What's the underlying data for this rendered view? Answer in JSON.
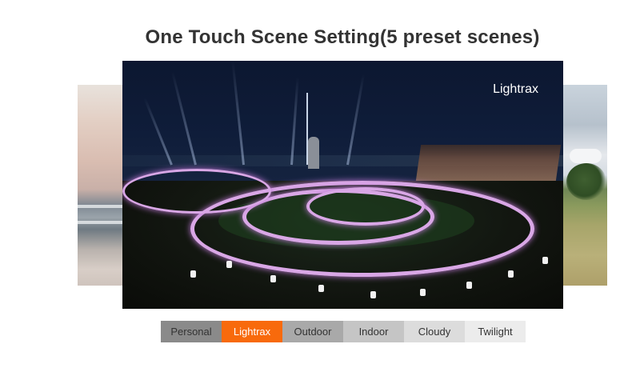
{
  "title": "One Touch Scene Setting(5 preset scenes)",
  "main_image": {
    "scene_label": "Lightrax"
  },
  "colors": {
    "accent": "#f86a0c",
    "text": "#333333"
  },
  "tabs": [
    {
      "label": "Personal",
      "bg": "#8a8a8a",
      "color": "#333333",
      "selected": false
    },
    {
      "label": "Lightrax",
      "bg": "#f86a0c",
      "color": "#ffffff",
      "selected": true
    },
    {
      "label": "Outdoor",
      "bg": "#a9a9a9",
      "color": "#333333",
      "selected": false
    },
    {
      "label": "Indoor",
      "bg": "#c5c5c5",
      "color": "#333333",
      "selected": false
    },
    {
      "label": "Cloudy",
      "bg": "#dcdcdc",
      "color": "#333333",
      "selected": false
    },
    {
      "label": "Twilight",
      "bg": "#ececec",
      "color": "#333333",
      "selected": false
    }
  ]
}
